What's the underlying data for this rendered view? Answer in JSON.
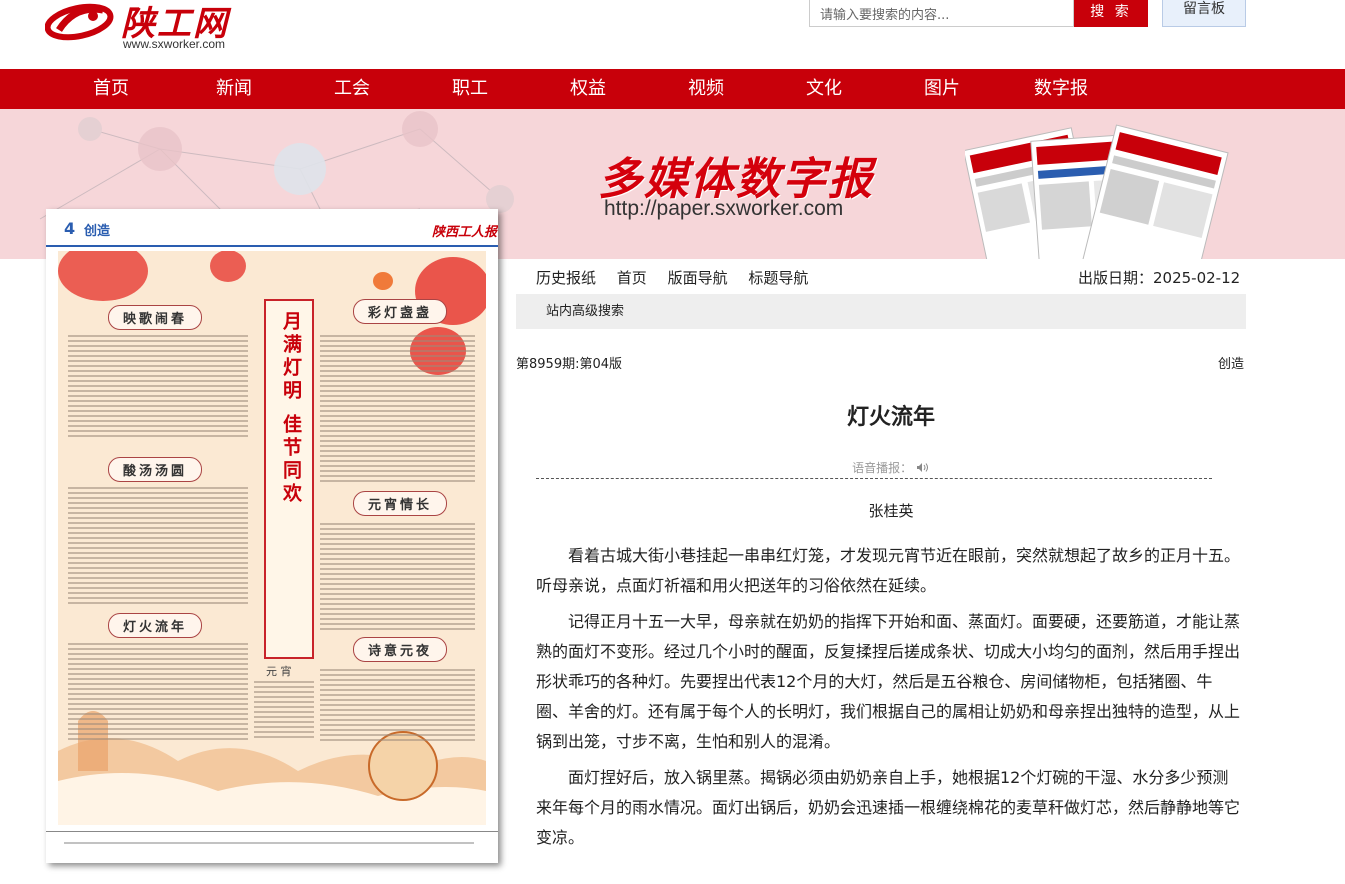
{
  "header": {
    "logo_text": "陕工网",
    "logo_url": "www.sxworker.com",
    "search_placeholder": "请输入要搜索的内容...",
    "search_button": "搜 索",
    "message_board": "留言板"
  },
  "nav": [
    "首页",
    "新闻",
    "工会",
    "职工",
    "权益",
    "视频",
    "文化",
    "图片",
    "数字报"
  ],
  "banner": {
    "title": "多媒体数字报",
    "url": "http://paper.sxworker.com"
  },
  "paper": {
    "page_num": "4",
    "section": "创造",
    "brand": "陕西工人报",
    "vertical_title": "月满灯明 佳节同欢",
    "columns": [
      "映歌闹春",
      "彩灯盏盏",
      "酸汤汤圆",
      "元宵情长",
      "灯火流年",
      "诗意元夜"
    ],
    "caption": "元 宵"
  },
  "subnav": {
    "items": [
      "历史报纸",
      "首页",
      "版面导航",
      "标题导航"
    ],
    "pub_date_label": "出版日期：2025-02-12"
  },
  "advanced_search": "站内高级搜索",
  "issue": "第8959期:第04版",
  "create": "创造",
  "article": {
    "title": "灯火流年",
    "voice_label": "语音播报：",
    "author": "张桂英",
    "paragraphs": [
      "看着古城大街小巷挂起一串串红灯笼，才发现元宵节近在眼前，突然就想起了故乡的正月十五。听母亲说，点面灯祈福和用火把送年的习俗依然在延续。",
      "记得正月十五一大早，母亲就在奶奶的指挥下开始和面、蒸面灯。面要硬，还要筋道，才能让蒸熟的面灯不变形。经过几个小时的醒面，反复揉捏后搓成条状、切成大小均匀的面剂，然后用手捏出形状乖巧的各种灯。先要捏出代表12个月的大灯，然后是五谷粮仓、房间储物柜，包括猪圈、牛圈、羊舍的灯。还有属于每个人的长明灯，我们根据自己的属相让奶奶和母亲捏出独特的造型，从上锅到出笼，寸步不离，生怕和别人的混淆。",
      "面灯捏好后，放入锅里蒸。揭锅必须由奶奶亲自上手，她根据12个灯碗的干湿、水分多少预测来年每个月的雨水情况。面灯出锅后，奶奶会迅速插一根缠绕棉花的麦草秆做灯芯，然后静静地等它变凉。"
    ]
  }
}
